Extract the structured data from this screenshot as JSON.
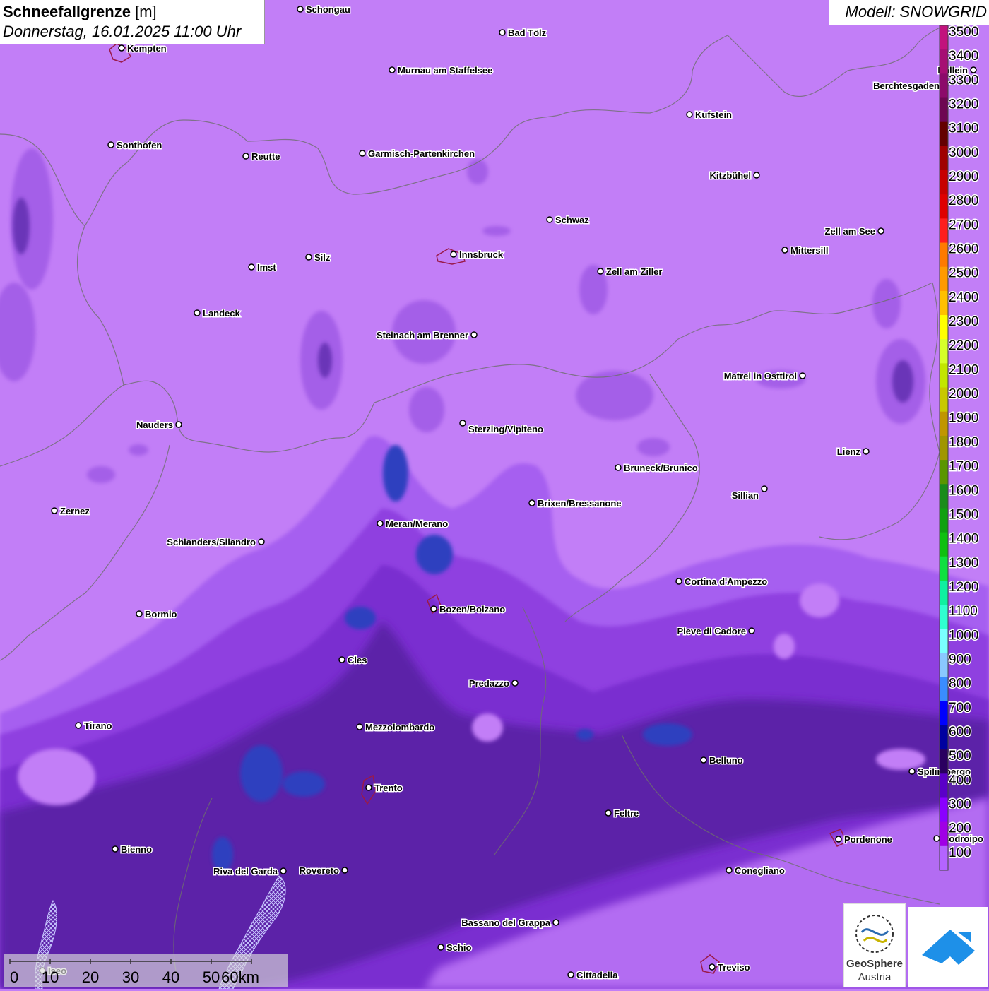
{
  "title": {
    "name": "Schneefallgrenze",
    "unit": "[m]",
    "datetime": "Donnerstag, 16.01.2025 11:00 Uhr"
  },
  "model_label": "Modell: SNOWGRID",
  "legend": {
    "levels": [
      "3500",
      "3400",
      "3300",
      "3200",
      "3100",
      "3000",
      "2900",
      "2800",
      "2700",
      "2600",
      "2500",
      "2400",
      "2300",
      "2200",
      "2100",
      "2000",
      "1900",
      "1800",
      "1700",
      "1600",
      "1500",
      "1400",
      "1300",
      "1200",
      "1100",
      "1000",
      "900",
      "800",
      "700",
      "600",
      "500",
      "400",
      "300",
      "200",
      "100"
    ],
    "colors": [
      "#c2127d",
      "#a60e73",
      "#8c0a6a",
      "#6e0652",
      "#640000",
      "#a00000",
      "#c80000",
      "#e00000",
      "#ff1e1e",
      "#ff7a00",
      "#ff9a00",
      "#ffc000",
      "#ffff00",
      "#d6ff2a",
      "#c2e600",
      "#c8c800",
      "#c09600",
      "#a09600",
      "#5a9600",
      "#1a8c1a",
      "#10a010",
      "#10c010",
      "#10e040",
      "#10f0a0",
      "#30ffd0",
      "#7affff",
      "#8ac8ff",
      "#3a8cff",
      "#0000ff",
      "#0000a0",
      "#2a0060",
      "#5a00c8",
      "#8a00ff",
      "#a000e6",
      "#b464ff"
    ]
  },
  "cities": [
    {
      "name": "Schongau"
    },
    {
      "name": "Bad Tölz"
    },
    {
      "name": "Kempten"
    },
    {
      "name": "Murnau am Staffelsee"
    },
    {
      "name": "Hallein"
    },
    {
      "name": "Berchtesgaden"
    },
    {
      "name": "Kufstein"
    },
    {
      "name": "Sonthofen"
    },
    {
      "name": "Reutte"
    },
    {
      "name": "Garmisch-Partenkirchen"
    },
    {
      "name": "Kitzbühel"
    },
    {
      "name": "Schwaz"
    },
    {
      "name": "Zell am See"
    },
    {
      "name": "Innsbruck"
    },
    {
      "name": "Mittersill"
    },
    {
      "name": "Silz"
    },
    {
      "name": "Imst"
    },
    {
      "name": "Zell am Ziller"
    },
    {
      "name": "Landeck"
    },
    {
      "name": "Steinach am Brenner"
    },
    {
      "name": "Matrei in Osttirol"
    },
    {
      "name": "Nauders"
    },
    {
      "name": "Sterzing/Vipiteno"
    },
    {
      "name": "Lienz"
    },
    {
      "name": "Bruneck/Brunico"
    },
    {
      "name": "Sillian"
    },
    {
      "name": "Zernez"
    },
    {
      "name": "Brixen/Bressanone"
    },
    {
      "name": "Meran/Merano"
    },
    {
      "name": "Schlanders/Silandro"
    },
    {
      "name": "Cortina d'Ampezzo"
    },
    {
      "name": "Bormio"
    },
    {
      "name": "Bozen/Bolzano"
    },
    {
      "name": "Pieve di Cadore"
    },
    {
      "name": "Cles"
    },
    {
      "name": "Predazzo"
    },
    {
      "name": "Tirano"
    },
    {
      "name": "Mezzolombardo"
    },
    {
      "name": "Belluno"
    },
    {
      "name": "Spilimbergo"
    },
    {
      "name": "Trento"
    },
    {
      "name": "Feltre"
    },
    {
      "name": "Pordenone"
    },
    {
      "name": "Codroipo"
    },
    {
      "name": "Bienno"
    },
    {
      "name": "Riva del Garda"
    },
    {
      "name": "Rovereto"
    },
    {
      "name": "Conegliano"
    },
    {
      "name": "Bassano del Grappa"
    },
    {
      "name": "Schio"
    },
    {
      "name": "Treviso"
    },
    {
      "name": "Cittadella"
    },
    {
      "name": "Iseo"
    }
  ],
  "scalebar": {
    "ticks": [
      "0",
      "10",
      "20",
      "30",
      "40",
      "50",
      "60km"
    ]
  },
  "logos": {
    "geosphere_line1": "GeoSphere",
    "geosphere_line2": "Austria"
  }
}
